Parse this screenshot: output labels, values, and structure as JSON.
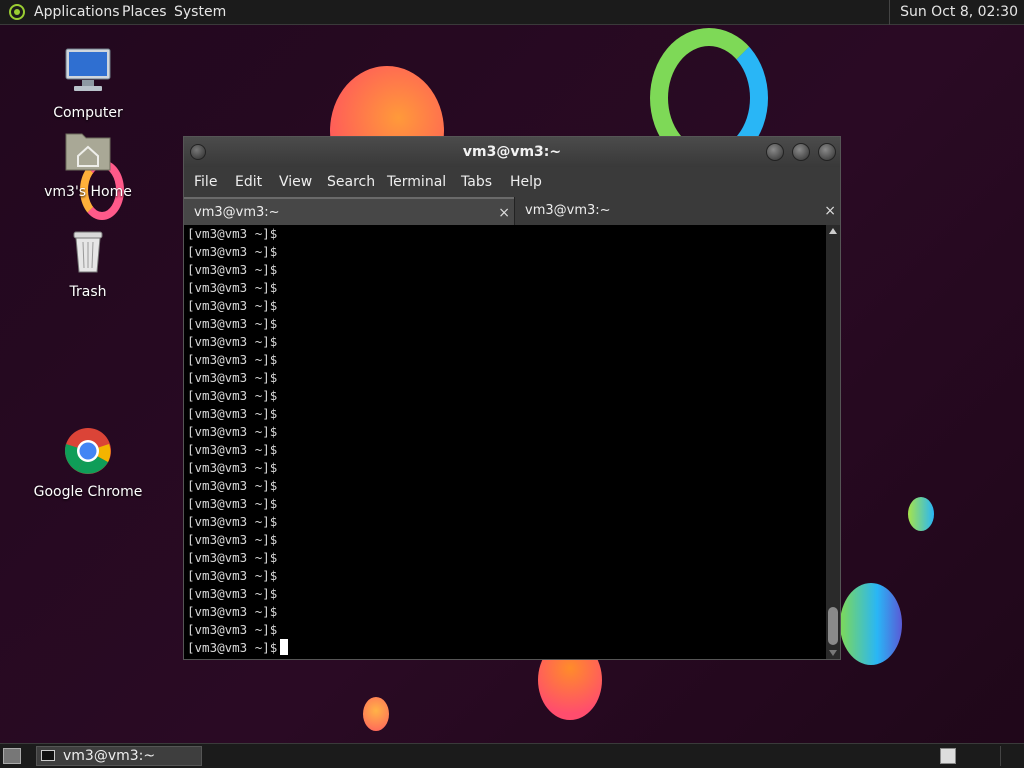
{
  "top_panel": {
    "applications": "Applications",
    "places": "Places",
    "system": "System",
    "clock": "Sun Oct  8, 02:30"
  },
  "desktop": {
    "icons": [
      {
        "label": "Computer"
      },
      {
        "label": "vm3's Home"
      },
      {
        "label": "Trash"
      },
      {
        "label": "Google Chrome"
      }
    ]
  },
  "window": {
    "title": "vm3@vm3:~",
    "menu": [
      "File",
      "Edit",
      "View",
      "Search",
      "Terminal",
      "Tabs",
      "Help"
    ],
    "tabs": [
      {
        "label": "vm3@vm3:~",
        "close": "×"
      },
      {
        "label": "vm3@vm3:~",
        "close": "×"
      }
    ],
    "terminal_lines": [
      "[vm3@vm3 ~]$",
      "[vm3@vm3 ~]$",
      "[vm3@vm3 ~]$",
      "[vm3@vm3 ~]$",
      "[vm3@vm3 ~]$",
      "[vm3@vm3 ~]$",
      "[vm3@vm3 ~]$",
      "[vm3@vm3 ~]$",
      "[vm3@vm3 ~]$",
      "[vm3@vm3 ~]$",
      "[vm3@vm3 ~]$",
      "[vm3@vm3 ~]$",
      "[vm3@vm3 ~]$",
      "[vm3@vm3 ~]$",
      "[vm3@vm3 ~]$",
      "[vm3@vm3 ~]$",
      "[vm3@vm3 ~]$",
      "[vm3@vm3 ~]$",
      "[vm3@vm3 ~]$",
      "[vm3@vm3 ~]$",
      "[vm3@vm3 ~]$",
      "[vm3@vm3 ~]$",
      "[vm3@vm3 ~]$"
    ],
    "prompt": "[vm3@vm3 ~]$"
  },
  "bottom_panel": {
    "task_label": "vm3@vm3:~"
  },
  "icons": {
    "apps": "gnome-foot-icon",
    "computer": "monitor-icon",
    "home": "home-folder-icon",
    "trash": "trash-icon",
    "chrome": "chrome-icon",
    "terminal": "terminal-icon"
  }
}
